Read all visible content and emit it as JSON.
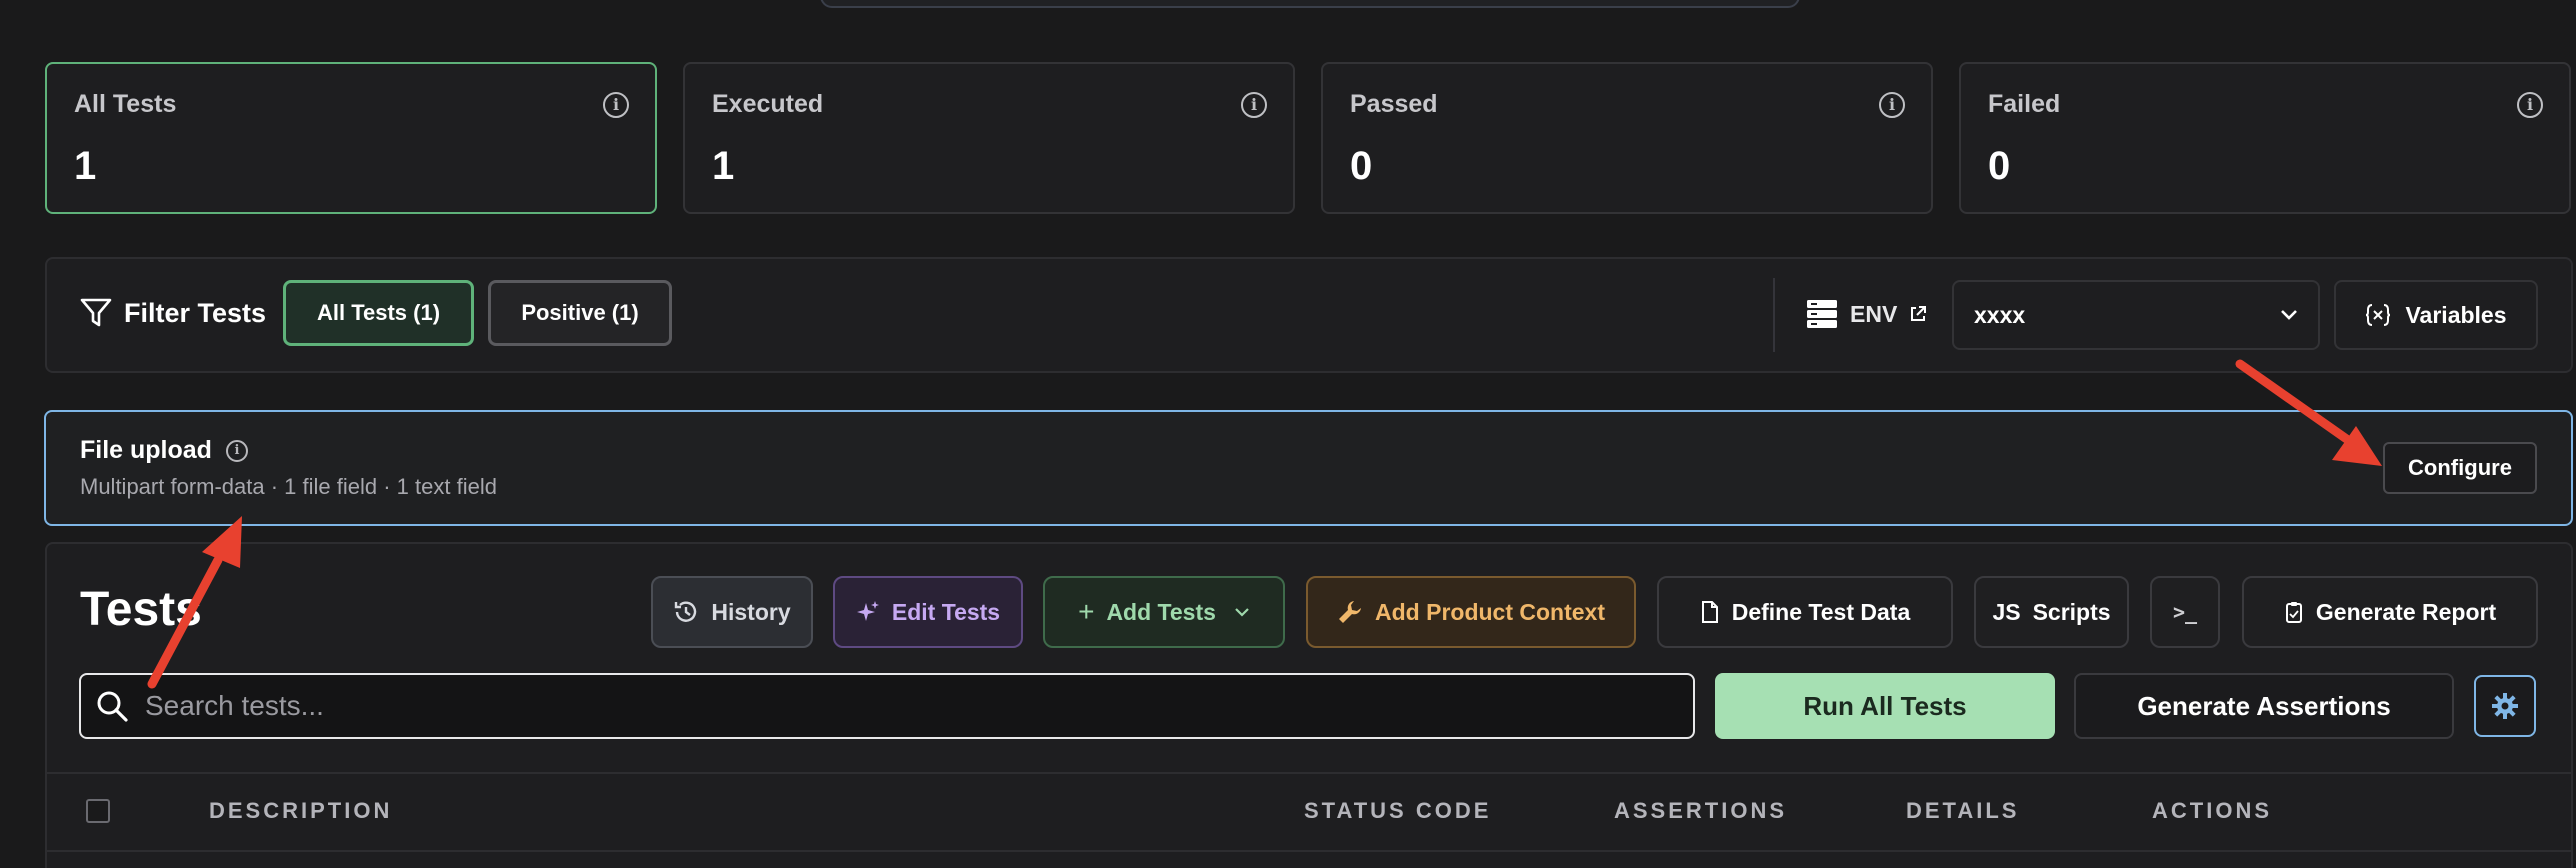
{
  "stats": [
    {
      "label": "All Tests",
      "value": "1",
      "active": true
    },
    {
      "label": "Executed",
      "value": "1",
      "active": false
    },
    {
      "label": "Passed",
      "value": "0",
      "active": false
    },
    {
      "label": "Failed",
      "value": "0",
      "active": false
    }
  ],
  "filter": {
    "title": "Filter Tests",
    "pills": [
      "All Tests (1)",
      "Positive (1)"
    ],
    "env_label": "ENV",
    "env_value": "xxxx",
    "variables_label": "Variables"
  },
  "upload": {
    "title": "File upload",
    "subtitle": "Multipart form-data · 1 file field · 1 text field",
    "configure_label": "Configure"
  },
  "tests": {
    "title": "Tests",
    "toolbar": {
      "history": "History",
      "edit_tests": "Edit Tests",
      "add_tests": "Add Tests",
      "add_product_context": "Add Product Context",
      "define_test_data": "Define Test Data",
      "scripts_prefix": "JS",
      "scripts": "Scripts",
      "terminal": ">_",
      "generate_report": "Generate Report"
    },
    "search_placeholder": "Search tests...",
    "run_all": "Run All Tests",
    "generate_assertions": "Generate Assertions",
    "columns": [
      "DESCRIPTION",
      "STATUS CODE",
      "ASSERTIONS",
      "DETAILS",
      "ACTIONS"
    ]
  },
  "colors": {
    "accent_green": "#5fb27a",
    "focus_blue": "#7fb6e6",
    "annotation_red": "#e8412f"
  }
}
